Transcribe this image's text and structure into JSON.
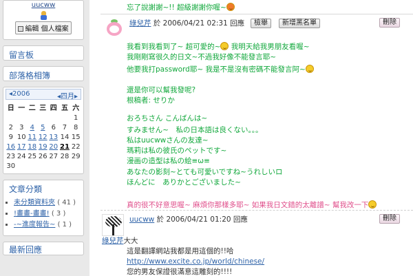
{
  "sidebar": {
    "profile": {
      "username": "uucww",
      "edit_button": "編輯 個人檔案"
    },
    "links": {
      "guestbook": "留言板",
      "blog_hangout": "部落格相簿"
    },
    "calendar": {
      "year_label": "2006",
      "month_label": "四月",
      "weekdays": [
        "日",
        "一",
        "二",
        "三",
        "四",
        "五",
        "六"
      ],
      "weeks": [
        [
          "",
          "",
          "",
          "",
          "",
          "",
          "1"
        ],
        [
          "2",
          "3",
          "4",
          "5",
          "6",
          "7",
          "8"
        ],
        [
          "9",
          "10",
          "11",
          "12",
          "13",
          "14",
          "15"
        ],
        [
          "16",
          "17",
          "18",
          "19",
          "20",
          "21",
          "22"
        ],
        [
          "23",
          "24",
          "25",
          "26",
          "27",
          "28",
          "29"
        ],
        [
          "30",
          "",
          "",
          "",
          "",
          "",
          ""
        ]
      ]
    },
    "categories": {
      "title": "文章分類",
      "items": [
        {
          "name": "未分類資料夾",
          "count": "( 41 )"
        },
        {
          "name": "!畫畫-畫畫!",
          "count": "( 3 )"
        },
        {
          "name": "-~進度報告~",
          "count": "( 1 )"
        }
      ]
    },
    "latest_title": "最新回應"
  },
  "main": {
    "top_line": "忘了說謝謝~!! 超級謝謝你喔~",
    "comment1": {
      "author": "綠兒芹",
      "meta": "於 2006/04/21 02:31 回應",
      "report_button": "檢舉",
      "blacklist_button": "新增黑名單",
      "delete_button": "刪除",
      "lines": [
        "我看到我看到了~ 超可愛的~",
        "我明天給我男朋友看喔~",
        "我剛剛寫很久的日文~不過我好像不能發言耶~",
        "他要我打password耶~ 我是不是沒有密碼不能發言阿~",
        "還是你可以幫我發呢?",
        "根稿者: せりか",
        "おろちさん こんばんは~",
        "すみません~　私の日本語は良くない。。。",
        "私はuucwwさんの友達~",
        "瑪莉は私の彼氏のペットです~",
        "漫画の造型は私の絵≡ω≡",
        "あなたの影刻~とても可愛いですね~うれしいロ",
        "ほんどに　ありかとございました~"
      ]
    },
    "reply1": "真的很不好意思喔~ 麻煩你那樣多耶~ 如果我日文錯的太離譜~ 幫我改一下",
    "comment2": {
      "author": "uucww",
      "meta": "於 2006/04/21 01:20 回應",
      "delete_button": "刪除",
      "mention": "綠兒芹",
      "mention_suffix": "大大",
      "lines": [
        "這是翻譯網站我都是用這個的!!哈",
        "http://www.excite.co.jp/world/chinese/",
        "您的男友保證很滿意這雕刻的!!!!"
      ]
    }
  }
}
